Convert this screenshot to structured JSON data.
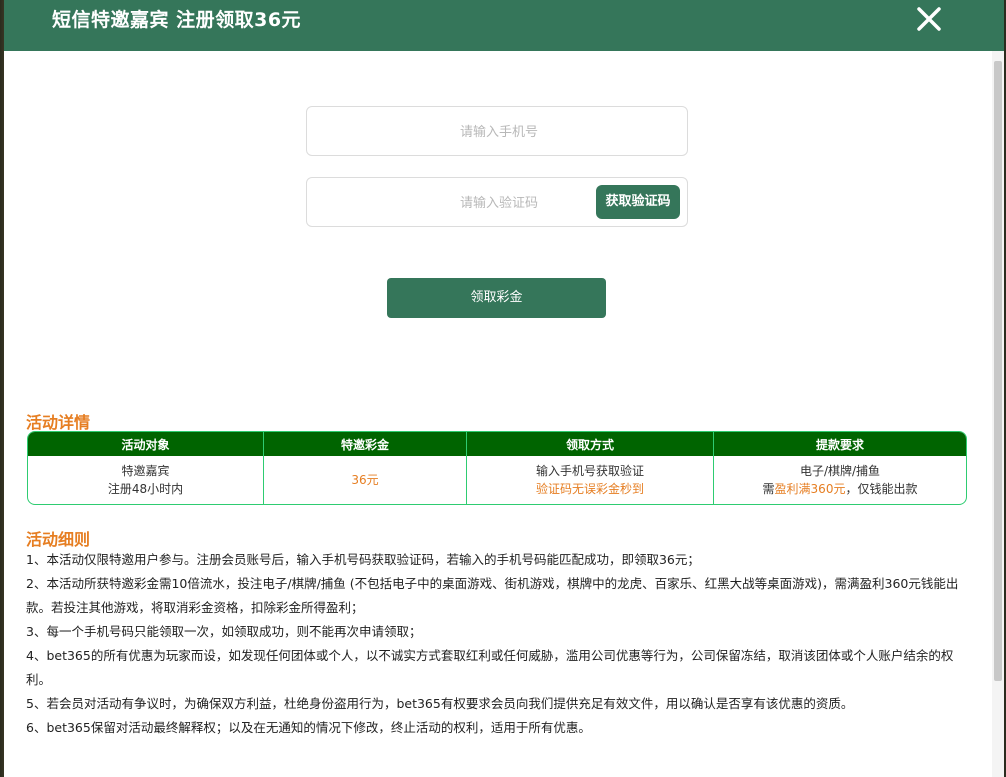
{
  "header": {
    "title": "短信特邀嘉宾 注册领取36元"
  },
  "form": {
    "phone_placeholder": "请输入手机号",
    "code_placeholder": "请输入验证码",
    "get_code_label": "获取验证码",
    "claim_label": "领取彩金"
  },
  "details": {
    "title": "活动详情",
    "headers": [
      "活动对象",
      "特邀彩金",
      "领取方式",
      "提款要求"
    ],
    "col1_line1": "特邀嘉宾",
    "col1_line2": "注册48小时内",
    "col2": "36元",
    "col3_line1": "输入手机号获取验证",
    "col3_line2": "验证码无误彩金秒到",
    "col4_line1": "电子/棋牌/捕鱼",
    "col4_line2_pre": "需",
    "col4_line2_hl": "盈利满360元",
    "col4_line2_post": "，仅钱能出款"
  },
  "rules": {
    "title": "活动细则",
    "items": [
      "1、本活动仅限特邀用户参与。注册会员账号后，输入手机号码获取验证码，若输入的手机号码能匹配成功，即领取36元；",
      "2、本活动所获特邀彩金需10倍流水，投注电子/棋牌/捕鱼 (不包括电子中的桌面游戏、街机游戏，棋牌中的龙虎、百家乐、红黑大战等桌面游戏)，需满盈利360元钱能出款。若投注其他游戏，将取消彩金资格，扣除彩金所得盈利；",
      "3、每一个手机号码只能领取一次，如领取成功，则不能再次申请领取；",
      "4、bet365的所有优惠为玩家而设，如发现任何团体或个人，以不诚实方式套取红利或任何威胁，滥用公司优惠等行为，公司保留冻结，取消该团体或个人账户结余的权利。",
      "5、若会员对活动有争议时，为确保双方利益，杜绝身份盗用行为，bet365有权要求会员向我们提供充足有效文件，用以确认是否享有该优惠的资质。",
      "6、bet365保留对活动最终解释权；以及在无通知的情况下修改，终止活动的权利，适用于所有优惠。"
    ]
  },
  "colors": {
    "brand": "#35765a",
    "table_header": "#006400",
    "accent": "#e67e22",
    "table_border": "#2ecc71"
  },
  "icons": {
    "close": "close-icon"
  }
}
